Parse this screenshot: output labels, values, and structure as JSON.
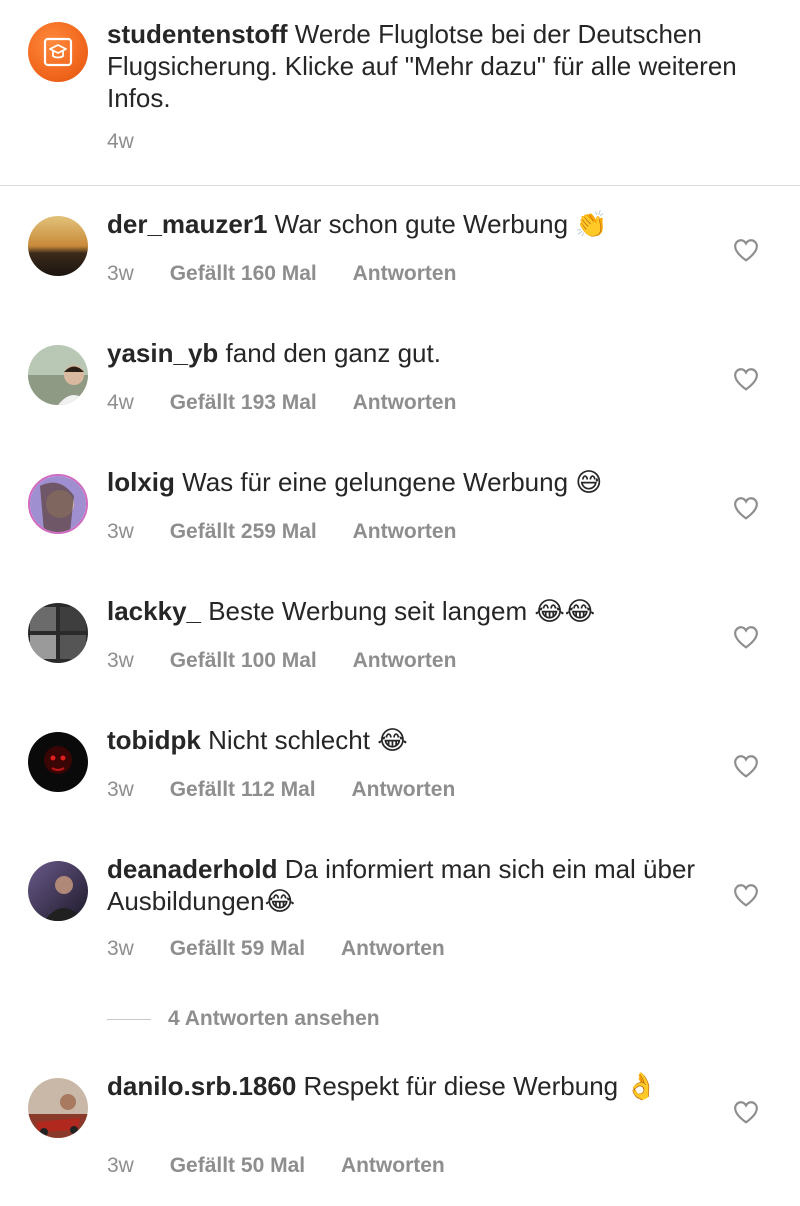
{
  "caption": {
    "username": "studentenstoff",
    "text": "Werde Fluglotse bei der Deutschen Flugsicherung. Klicke auf \"Mehr dazu\" für alle weiteren Infos.",
    "time": "4w",
    "avatar_icon": "graduation-cap-icon",
    "accent_color": "#f26a1f"
  },
  "comments": [
    {
      "username": "der_mauzer1",
      "text": "War schon gute Werbung",
      "emoji": "👏",
      "time": "3w",
      "likes": "Gefällt 160 Mal",
      "reply": "Antworten"
    },
    {
      "username": "yasin_yb",
      "text": "fand den ganz gut.",
      "emoji": "",
      "time": "4w",
      "likes": "Gefällt 193 Mal",
      "reply": "Antworten"
    },
    {
      "username": "lolxig",
      "text": "Was für eine gelungene Werbung",
      "emoji": "😅",
      "time": "3w",
      "likes": "Gefällt 259 Mal",
      "reply": "Antworten"
    },
    {
      "username": "lackky_",
      "text": "Beste Werbung seit langem",
      "emoji": "😂😂",
      "time": "3w",
      "likes": "Gefällt 100 Mal",
      "reply": "Antworten"
    },
    {
      "username": "tobidpk",
      "text": "Nicht schlecht",
      "emoji": "😂",
      "time": "3w",
      "likes": "Gefällt 112 Mal",
      "reply": "Antworten"
    },
    {
      "username": "deanaderhold",
      "text": "Da informiert man sich ein mal über Ausbildungen",
      "emoji": "😂",
      "time": "3w",
      "likes": "Gefällt 59 Mal",
      "reply": "Antworten"
    },
    {
      "username": "danilo.srb.1860",
      "text": "Respekt für diese Werbung",
      "emoji": "👌",
      "time": "3w",
      "likes": "Gefällt 50 Mal",
      "reply": "Antworten"
    }
  ],
  "view_replies": "4 Antworten ansehen",
  "colors": {
    "text": "#262626",
    "secondary": "#8e8e8e",
    "divider": "#dbdbdb"
  }
}
